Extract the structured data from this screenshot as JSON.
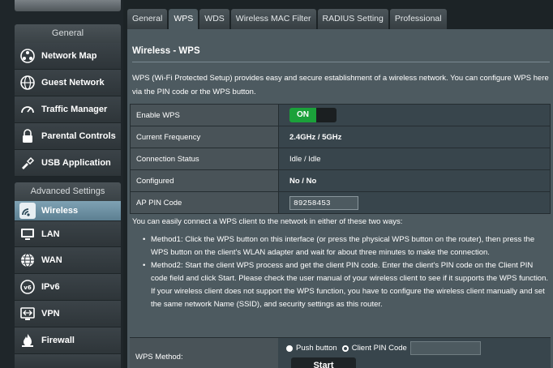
{
  "sidebar": {
    "general_title": "General",
    "general_items": [
      {
        "label": "Network Map",
        "icon": "network-map-icon"
      },
      {
        "label": "Guest Network",
        "icon": "globe-icon"
      },
      {
        "label": "Traffic Manager",
        "icon": "gauge-icon"
      },
      {
        "label": "Parental Controls",
        "icon": "lock-icon"
      },
      {
        "label": "USB Application",
        "icon": "puzzle-icon"
      }
    ],
    "advanced_title": "Advanced Settings",
    "advanced_items": [
      {
        "label": "Wireless",
        "icon": "wifi-icon",
        "active": true
      },
      {
        "label": "LAN",
        "icon": "monitor-icon"
      },
      {
        "label": "WAN",
        "icon": "globe-icon"
      },
      {
        "label": "IPv6",
        "icon": "ipv6-globe-icon"
      },
      {
        "label": "VPN",
        "icon": "vpn-icon"
      },
      {
        "label": "Firewall",
        "icon": "fire-icon"
      }
    ]
  },
  "tabs": [
    "General",
    "WPS",
    "WDS",
    "Wireless MAC Filter",
    "RADIUS Setting",
    "Professional"
  ],
  "active_tab": "WPS",
  "panel": {
    "title": "Wireless - WPS",
    "description": "WPS (Wi-Fi Protected Setup) provides easy and secure establishment of a wireless network. You can configure WPS here via the PIN code or the WPS button."
  },
  "settings": {
    "enable_wps": {
      "label": "Enable WPS",
      "value": "ON"
    },
    "frequency": {
      "label": "Current Frequency",
      "value": "2.4GHz / 5GHz"
    },
    "status": {
      "label": "Connection Status",
      "value": "Idle / Idle"
    },
    "configured": {
      "label": "Configured",
      "value": "No / No"
    },
    "ap_pin": {
      "label": "AP PIN Code",
      "value": "89258453"
    }
  },
  "info": {
    "intro": "You can easily connect a WPS client to the network in either of these two ways:",
    "method1": "Method1: Click the WPS button on this interface (or press the physical WPS button on the router), then press the WPS button on the client's WLAN adapter and wait for about three minutes to make the connection.",
    "method2": "Method2: Start the client WPS process and get the client PIN code. Enter the client's PIN code on the Client PIN code field and click Start. Please check the user manual of your wireless client to see if it supports the WPS function. If your wireless client does not support the WPS function, you have to configure the wireless client manually and set the same network Name (SSID), and security settings as this router."
  },
  "wps_method": {
    "label": "WPS Method:",
    "push_button": "Push button",
    "client_pin": "Client PIN Code",
    "selected": "Push button",
    "client_pin_value": "",
    "start": "Start"
  },
  "colors": {
    "on_green": "#1ba13a",
    "status_yellow": "#ffcc33",
    "active_item": "#6f93a5"
  }
}
